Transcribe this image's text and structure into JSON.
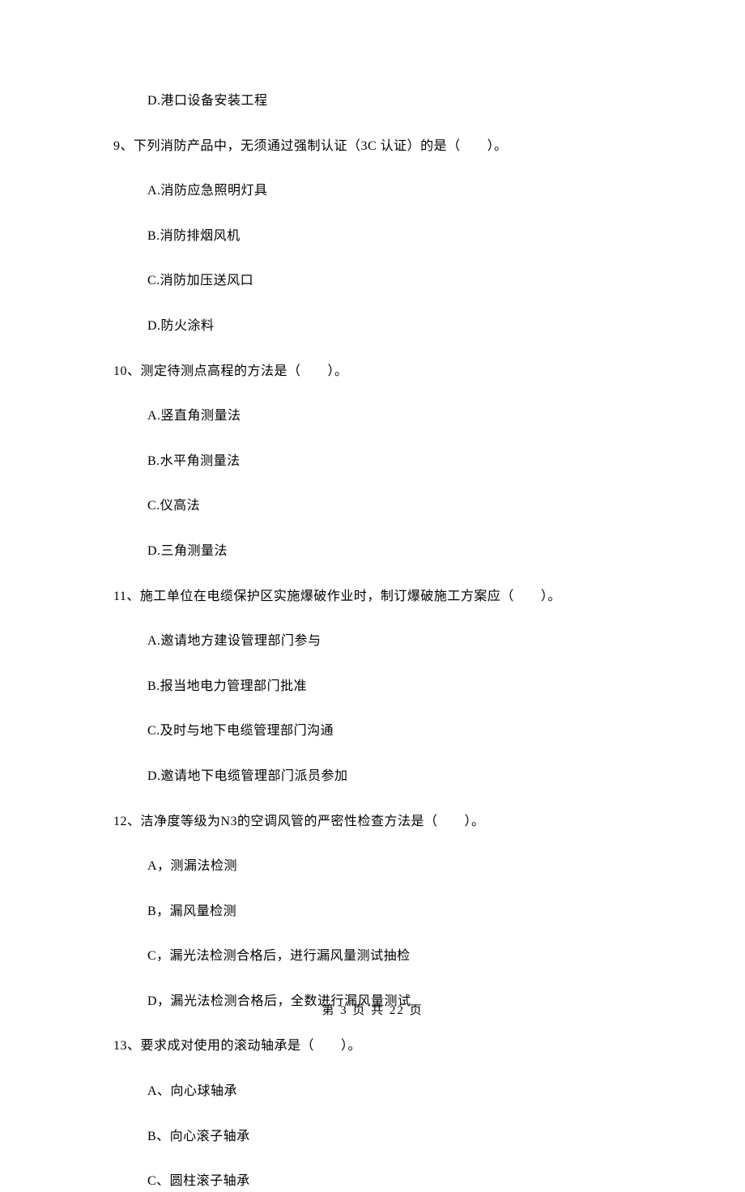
{
  "q8": {
    "d": "D.港口设备安装工程"
  },
  "q9": {
    "stem": "9、下列消防产品中，无须通过强制认证（3C 认证）的是（　　）。",
    "a": "A.消防应急照明灯具",
    "b": "B.消防排烟风机",
    "c": "C.消防加压送风口",
    "d": "D.防火涂料"
  },
  "q10": {
    "stem": "10、测定待测点高程的方法是（　　）。",
    "a": "A.竖直角测量法",
    "b": "B.水平角测量法",
    "c": "C.仪高法",
    "d": "D.三角测量法"
  },
  "q11": {
    "stem": "11、施工单位在电缆保护区实施爆破作业时，制订爆破施工方案应（　　）。",
    "a": "A.邀请地方建设管理部门参与",
    "b": "B.报当地电力管理部门批准",
    "c": "C.及时与地下电缆管理部门沟通",
    "d": "D.邀请地下电缆管理部门派员参加"
  },
  "q12": {
    "stem": "12、洁净度等级为N3的空调风管的严密性检查方法是（　　）。",
    "a": "A，测漏法检测",
    "b": "B，漏风量检测",
    "c": "C，漏光法检测合格后，进行漏风量测试抽检",
    "d": "D，漏光法检测合格后，全数进行漏风量测试"
  },
  "q13": {
    "stem": "13、要求成对使用的滚动轴承是（　　）。",
    "a": "A、向心球轴承",
    "b": "B、向心滚子轴承",
    "c": "C、圆柱滚子轴承"
  },
  "footer": "第 3 页 共 22 页"
}
